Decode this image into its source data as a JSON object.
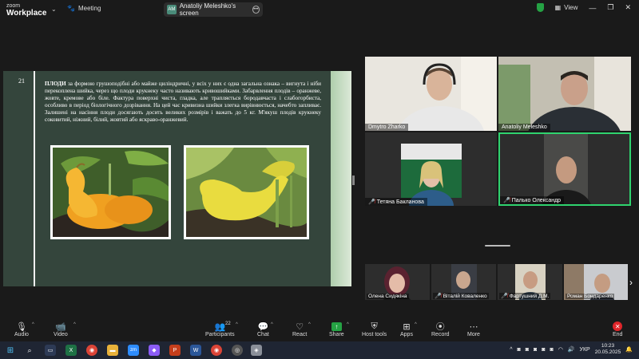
{
  "app": {
    "logo_line1": "zoom",
    "logo_line2": "Workplace",
    "meeting_label": "Meeting",
    "share_badge": "AM",
    "share_title": "Anatoliy Meleshko's screen",
    "view_label": "View"
  },
  "slide": {
    "number": "21",
    "bold_word": "ПЛОДИ",
    "text": " за формою грушоподібні або майже циліндричні, у всіх у них є одна загальна ознака – вигнута і ніби перекоплена шийка, через що плоди крукнеку часто називають кривошийками. Забарвлення плодів – оранжеве, жовте, кремове або біле. Фактура поверхні чиста, гладка, але трапляється бородавчаста і слабогорбиста, особливо в період біологічного дозрівання. На цей час кривизна шийки злегка вирівнюється, начебто запливає. Залишені на насіння плоди досягають досить великих розмірів і важать до 5 кг. М'якуш плодів крукнеку соковитий, ніжний, білий, жовтий або яскраво-оранжевий."
  },
  "participants_grid": [
    {
      "name": "Dmytro Zharko",
      "muted": false
    },
    {
      "name": "Anatoliy Meleshko",
      "muted": false
    },
    {
      "name": "Тетяна Бакланова",
      "muted": true
    },
    {
      "name": "Палько Олександр",
      "muted": true
    }
  ],
  "participants_strip": [
    {
      "name": "Олена Сидякіна",
      "muted": false
    },
    {
      "name": "Віталій Коваленко",
      "muted": true
    },
    {
      "name": "Фартушний Д.М.",
      "muted": true
    },
    {
      "name": "Роман Бондаренко",
      "muted": false
    }
  ],
  "toolbar": {
    "audio": "Audio",
    "video": "Video",
    "participants": "Participants",
    "participants_count": "22",
    "chat": "Chat",
    "react": "React",
    "share": "Share",
    "host_tools": "Host tools",
    "apps": "Apps",
    "record": "Record",
    "more": "More",
    "end": "End"
  },
  "taskbar": {
    "lang": "УКР",
    "time": "10:23",
    "date": "20.05.2025"
  },
  "colors": {
    "active_speaker": "#2fd36e",
    "share_green": "#25a244",
    "end_red": "#e0262b",
    "slide_bg": "#34453c"
  }
}
